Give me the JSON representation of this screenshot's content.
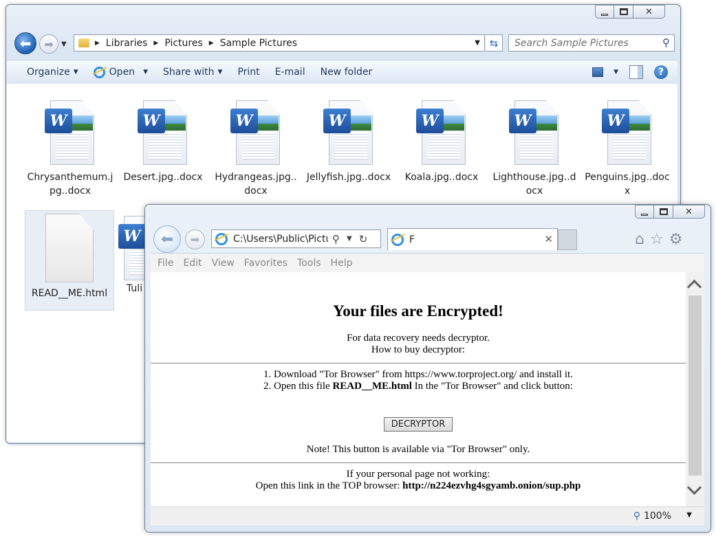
{
  "explorer": {
    "breadcrumb": [
      "Libraries",
      "Pictures",
      "Sample Pictures"
    ],
    "search_placeholder": "Search Sample Pictures",
    "commands": {
      "organize": "Organize",
      "open": "Open",
      "share_with": "Share with",
      "print": "Print",
      "email": "E-mail",
      "new_folder": "New folder"
    },
    "files": [
      {
        "name": "Chrysanthemum.jpg..docx",
        "line1": "Chrysanthemum.j",
        "line2": "pg..docx",
        "type": "word"
      },
      {
        "name": "Desert.jpg..docx",
        "line1": "Desert.jpg..docx",
        "line2": "",
        "type": "word"
      },
      {
        "name": "Hydrangeas.jpg..docx",
        "line1": "Hydrangeas.jpg..",
        "line2": "docx",
        "type": "word"
      },
      {
        "name": "Jellyfish.jpg..docx",
        "line1": "Jellyfish.jpg..docx",
        "line2": "",
        "type": "word"
      },
      {
        "name": "Koala.jpg..docx",
        "line1": "Koala.jpg..docx",
        "line2": "",
        "type": "word"
      },
      {
        "name": "Lighthouse.jpg..docx",
        "line1": "Lighthouse.jpg..d",
        "line2": "ocx",
        "type": "word"
      },
      {
        "name": "Penguins.jpg..docx",
        "line1": "Penguins.jpg..doc",
        "line2": "x",
        "type": "word"
      },
      {
        "name": "READ__ME.html",
        "line1": "READ__ME.html",
        "line2": "",
        "type": "html",
        "selected": true
      },
      {
        "name": "Tuli",
        "line1": "Tuli",
        "line2": "",
        "type": "word"
      }
    ]
  },
  "ie": {
    "address": "C:\\Users\\Public\\Pictu",
    "tab_title": "F",
    "menu": [
      "File",
      "Edit",
      "View",
      "Favorites",
      "Tools",
      "Help"
    ],
    "zoom": "100%",
    "page": {
      "title": "Your files are Encrypted!",
      "line1": "For data recovery needs decryptor.",
      "line2": "How to buy decryptor:",
      "step1": "1. Download \"Tor Browser\" from https://www.torproject.org/ and install it.",
      "step2_prefix": "2. Open this file ",
      "step2_file": "READ__ME.html",
      "step2_suffix": " In the \"Tor Browser\" and click button:",
      "button": "DECRYPTOR",
      "note": "Note! This button is available via \"Tor Browser\" only.",
      "fallback1": "If your personal page not working:",
      "fallback2_prefix": "Open this link in the TOP browser: ",
      "fallback2_link": "http://n224ezvhg4sgyamb.onion/sup.php"
    }
  },
  "colors": {
    "accent": "#1a5fb4",
    "cmdbar_text": "#1f3a5f",
    "word_blue": "#1d4d9a"
  }
}
